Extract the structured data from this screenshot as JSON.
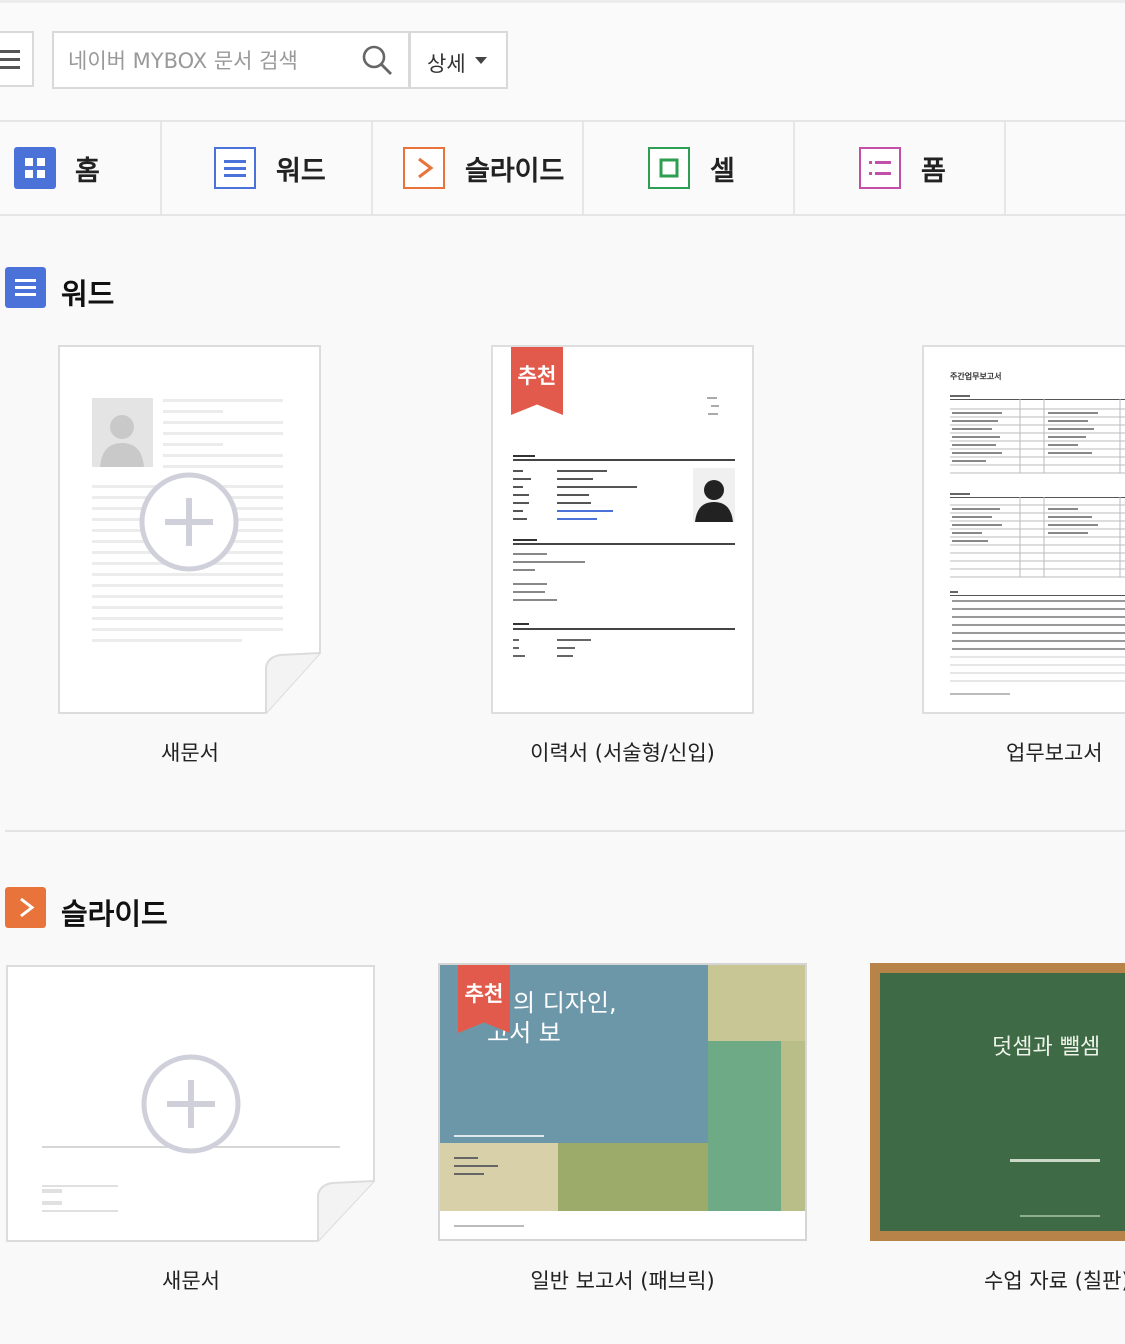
{
  "search": {
    "placeholder": "네이버 MYBOX 문서 검색",
    "detail_label": "상세"
  },
  "tabs": [
    {
      "label": "홈",
      "icon": "home-grid-icon",
      "color": "#4a72d8"
    },
    {
      "label": "워드",
      "icon": "word-icon",
      "color": "#4a72d8"
    },
    {
      "label": "슬라이드",
      "icon": "slide-icon",
      "color": "#e8743b"
    },
    {
      "label": "셀",
      "icon": "cell-icon",
      "color": "#2e9e52"
    },
    {
      "label": "폼",
      "icon": "form-icon",
      "color": "#c24fa8"
    }
  ],
  "sections": {
    "word": {
      "title": "워드",
      "templates": [
        {
          "caption": "새문서"
        },
        {
          "caption": "이력서 (서술형/신입)",
          "badge": "추천"
        },
        {
          "caption": "업무보고서",
          "doc_heading": "주간업무보고서"
        }
      ]
    },
    "slide": {
      "title": "슬라이드",
      "templates": [
        {
          "caption": "새문서"
        },
        {
          "caption": "일반 보고서 (패브릭)",
          "badge": "추천",
          "slide_title_1": "의 디자인,",
          "slide_title_2": "고서 보"
        },
        {
          "caption": "수업 자료 (칠판)",
          "slide_title": "덧셈과 뺄셈"
        }
      ]
    }
  }
}
